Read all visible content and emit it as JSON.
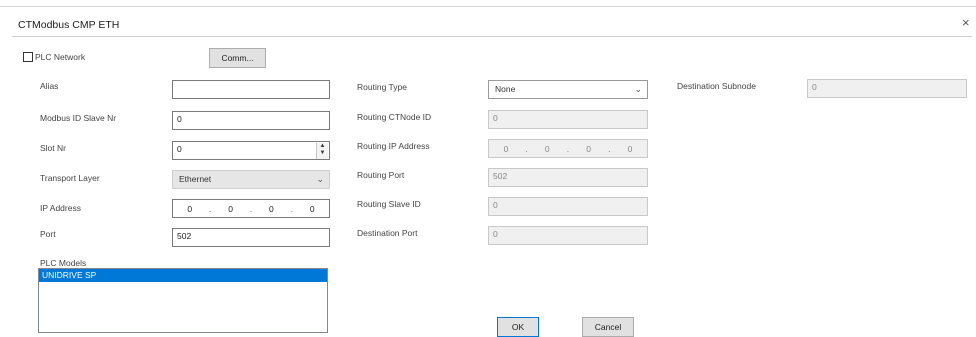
{
  "window": {
    "title": "CTModbus CMP ETH",
    "close_glyph": "×"
  },
  "plc_network": {
    "label": "PLC Network",
    "checked": false
  },
  "comm_button": "Comm...",
  "left": {
    "alias": {
      "label": "Alias",
      "value": ""
    },
    "slave_nr": {
      "label": "Modbus ID Slave Nr",
      "value": "0"
    },
    "slot_nr": {
      "label": "Slot Nr",
      "value": "0",
      "spin_up": "▲",
      "spin_down": "▼"
    },
    "transport": {
      "label": "Transport Layer",
      "value": "Ethernet"
    },
    "ip_address": {
      "label": "IP Address",
      "octets": [
        "0",
        "0",
        "0",
        "0"
      ],
      "dot": "."
    },
    "port": {
      "label": "Port",
      "value": "502"
    }
  },
  "plc_models": {
    "label": "PLC Models",
    "items": [
      "UNIDRIVE SP"
    ]
  },
  "right": {
    "routing_type": {
      "label": "Routing Type",
      "value": "None"
    },
    "routing_ctnode": {
      "label": "Routing CTNode ID",
      "value": "0"
    },
    "routing_ip": {
      "label": "Routing IP Address",
      "octets": [
        "0",
        "0",
        "0",
        "0"
      ],
      "dot": "."
    },
    "routing_port": {
      "label": "Routing Port",
      "value": "502"
    },
    "routing_slave": {
      "label": "Routing Slave ID",
      "value": "0"
    },
    "destination_port": {
      "label": "Destination Port",
      "value": "0"
    }
  },
  "destination_subnode": {
    "label": "Destination Subnode",
    "value": "0"
  },
  "buttons": {
    "ok": "OK",
    "cancel": "Cancel"
  },
  "icons": {
    "chevron": "chevron-down-icon",
    "close": "close-icon"
  }
}
